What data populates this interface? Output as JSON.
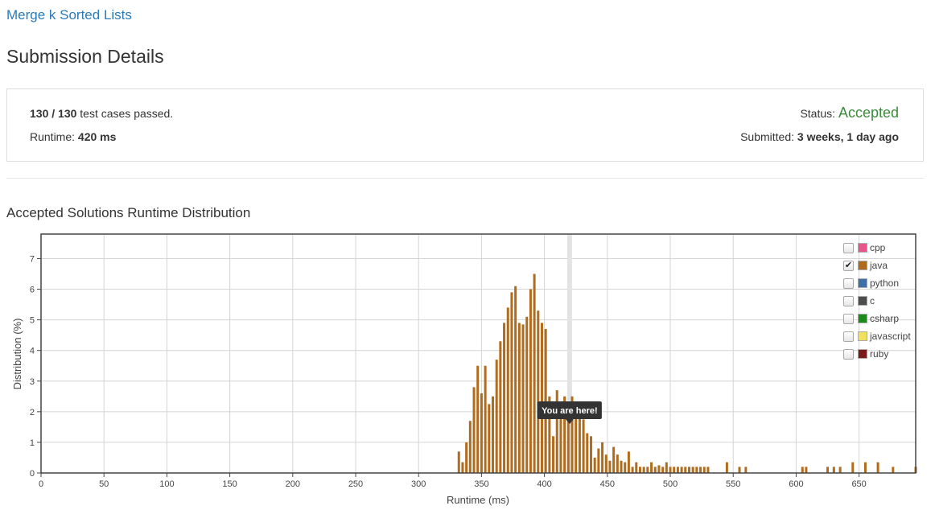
{
  "problem": {
    "title": "Merge k Sorted Lists"
  },
  "page": {
    "title": "Submission Details"
  },
  "summary": {
    "passed": "130",
    "separator": "/",
    "total": "130",
    "passed_suffix": "test cases passed.",
    "runtime_label": "Runtime:",
    "runtime_value": "420 ms",
    "status_label": "Status:",
    "status_value": "Accepted",
    "status_color": "#3c8a3c",
    "submitted_label": "Submitted:",
    "submitted_value": "3 weeks, 1 day ago"
  },
  "chart": {
    "title": "Accepted Solutions Runtime Distribution",
    "marker_label": "You are here!"
  },
  "legend": [
    {
      "label": "cpp",
      "color": "#e8558a",
      "checked": false
    },
    {
      "label": "java",
      "color": "#b06c1e",
      "checked": true
    },
    {
      "label": "python",
      "color": "#3d6fa8",
      "checked": false
    },
    {
      "label": "c",
      "color": "#4d4d4d",
      "checked": false
    },
    {
      "label": "csharp",
      "color": "#1a8a1a",
      "checked": false
    },
    {
      "label": "javascript",
      "color": "#f0e05a",
      "checked": false
    },
    {
      "label": "ruby",
      "color": "#7a1a1a",
      "checked": false
    }
  ],
  "chart_data": {
    "type": "bar",
    "xlabel": "Runtime (ms)",
    "ylabel": "Distribution (%)",
    "xlim": [
      0,
      695
    ],
    "ylim": [
      0,
      7.8
    ],
    "xticks": [
      "0",
      "50",
      "100",
      "150",
      "200",
      "250",
      "300",
      "350",
      "400",
      "450",
      "500",
      "550",
      "600",
      "650"
    ],
    "yticks": [
      "0",
      "1",
      "2",
      "3",
      "4",
      "5",
      "6",
      "7"
    ],
    "grid": true,
    "highlight_x": 420,
    "bar_color": "#b06c1e",
    "series": [
      {
        "name": "java",
        "x": [
          332,
          335,
          338,
          341,
          344,
          347,
          350,
          353,
          356,
          359,
          362,
          365,
          368,
          371,
          374,
          377,
          380,
          383,
          386,
          389,
          392,
          395,
          398,
          401,
          404,
          407,
          410,
          413,
          416,
          419,
          422,
          425,
          428,
          431,
          434,
          437,
          440,
          443,
          446,
          449,
          452,
          455,
          458,
          461,
          464,
          467,
          470,
          473,
          476,
          479,
          482,
          485,
          488,
          491,
          494,
          497,
          500,
          503,
          506,
          509,
          512,
          515,
          518,
          521,
          524,
          527,
          530,
          545,
          555,
          560,
          605,
          608,
          625,
          630,
          635,
          645,
          655,
          665,
          677,
          695
        ],
        "values": [
          0.7,
          0.35,
          1.0,
          1.7,
          2.8,
          3.5,
          2.6,
          3.5,
          2.25,
          2.5,
          3.7,
          4.3,
          4.9,
          5.4,
          5.9,
          6.1,
          4.9,
          4.85,
          5.1,
          6.0,
          6.5,
          5.3,
          4.9,
          4.7,
          2.5,
          1.2,
          2.7,
          2.0,
          2.5,
          2.3,
          2.5,
          2.3,
          2.3,
          1.75,
          1.3,
          1.2,
          0.5,
          0.8,
          1.0,
          0.6,
          0.4,
          0.85,
          0.6,
          0.4,
          0.35,
          0.7,
          0.2,
          0.35,
          0.2,
          0.2,
          0.2,
          0.35,
          0.2,
          0.25,
          0.2,
          0.35,
          0.2,
          0.2,
          0.2,
          0.2,
          0.2,
          0.2,
          0.2,
          0.2,
          0.2,
          0.2,
          0.2,
          0.35,
          0.2,
          0.2,
          0.2,
          0.2,
          0.2,
          0.2,
          0.2,
          0.35,
          0.35,
          0.35,
          0.2,
          0.2
        ]
      }
    ]
  }
}
